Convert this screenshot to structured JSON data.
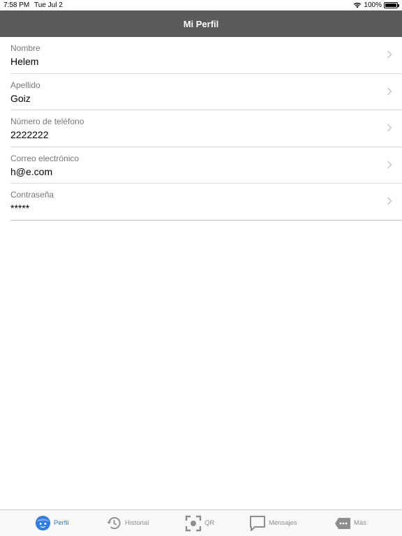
{
  "status_bar": {
    "time": "7:58 PM",
    "date": "Tue Jul 2",
    "battery": "100%"
  },
  "nav": {
    "title": "Mi Perfil"
  },
  "profile": [
    {
      "label": "Nombre",
      "value": "Helem"
    },
    {
      "label": "Apellido",
      "value": "Goiz"
    },
    {
      "label": "Número de teléfono",
      "value": "2222222"
    },
    {
      "label": "Correo electrónico",
      "value": "h@e.com"
    },
    {
      "label": "Contraseña",
      "value": "*****"
    }
  ],
  "tabs": [
    {
      "label": "Perfil",
      "icon": "face-icon",
      "active": true
    },
    {
      "label": "Historial",
      "icon": "history-icon",
      "active": false
    },
    {
      "label": "QR",
      "icon": "qr-scan-icon",
      "active": false
    },
    {
      "label": "Mensajes",
      "icon": "message-icon",
      "active": false
    },
    {
      "label": "Más",
      "icon": "more-tag-icon",
      "active": false
    }
  ],
  "colors": {
    "nav_bg": "#5b5b5b",
    "active_tab": "#2f7de1",
    "inactive_tab": "#8e8e8e"
  }
}
